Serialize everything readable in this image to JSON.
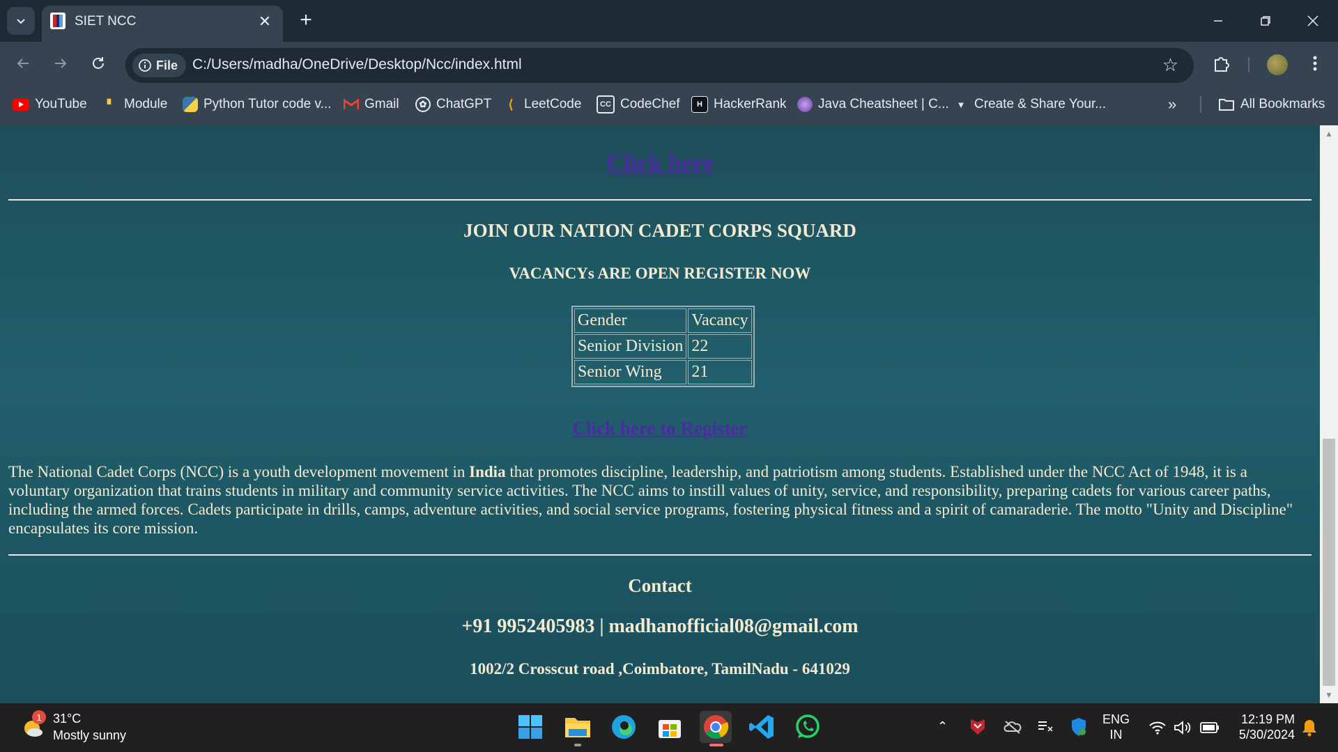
{
  "browser": {
    "tab_title": "SIET NCC",
    "url_chip": "File",
    "url": "C:/Users/madha/OneDrive/Desktop/Ncc/index.html",
    "bookmarks": [
      "YouTube",
      "Module",
      "Python Tutor code v...",
      "Gmail",
      "ChatGPT",
      "LeetCode",
      "CodeChef",
      "HackerRank",
      "Java Cheatsheet | C...",
      "Create & Share Your..."
    ],
    "all_bookmarks": "All Bookmarks"
  },
  "page": {
    "top_link": "Click here",
    "join_heading": "JOIN OUR NATION CADET CORPS SQUARD",
    "vacancy_heading": "VACANCYs ARE OPEN REGISTER NOW",
    "table": {
      "headers": [
        "Gender",
        "Vacancy"
      ],
      "rows": [
        [
          "Senior Division",
          "22"
        ],
        [
          "Senior Wing",
          "21"
        ]
      ]
    },
    "register_link": "Click here to Register",
    "about": {
      "before": "The National Cadet Corps (NCC) is a youth development movement in ",
      "bold": "India",
      "after": " that promotes discipline, leadership, and patriotism among students. Established under the NCC Act of 1948, it is a voluntary organization that trains students in military and community service activities. The NCC aims to instill values of unity, service, and responsibility, preparing cadets for various career paths, including the armed forces. Cadets participate in drills, camps, adventure activities, and social service programs, fostering physical fitness and a spirit of camaraderie. The motto \"Unity and Discipline\" encapsulates its core mission."
    },
    "contact_heading": "Contact",
    "contact_line": "+91 9952405983 | madhanofficial08@gmail.com",
    "address": "1002/2 Crosscut road ,Coimbatore, TamilNadu - 641029"
  },
  "taskbar": {
    "weather_badge": "1",
    "temperature": "31°C",
    "weather": "Mostly sunny",
    "lang_top": "ENG",
    "lang_bottom": "IN",
    "time": "12:19 PM",
    "date": "5/30/2024"
  },
  "colors": {
    "link": "#4b2aa3",
    "page_text": "#f3ead0",
    "page_bg": "#1e5a66"
  }
}
